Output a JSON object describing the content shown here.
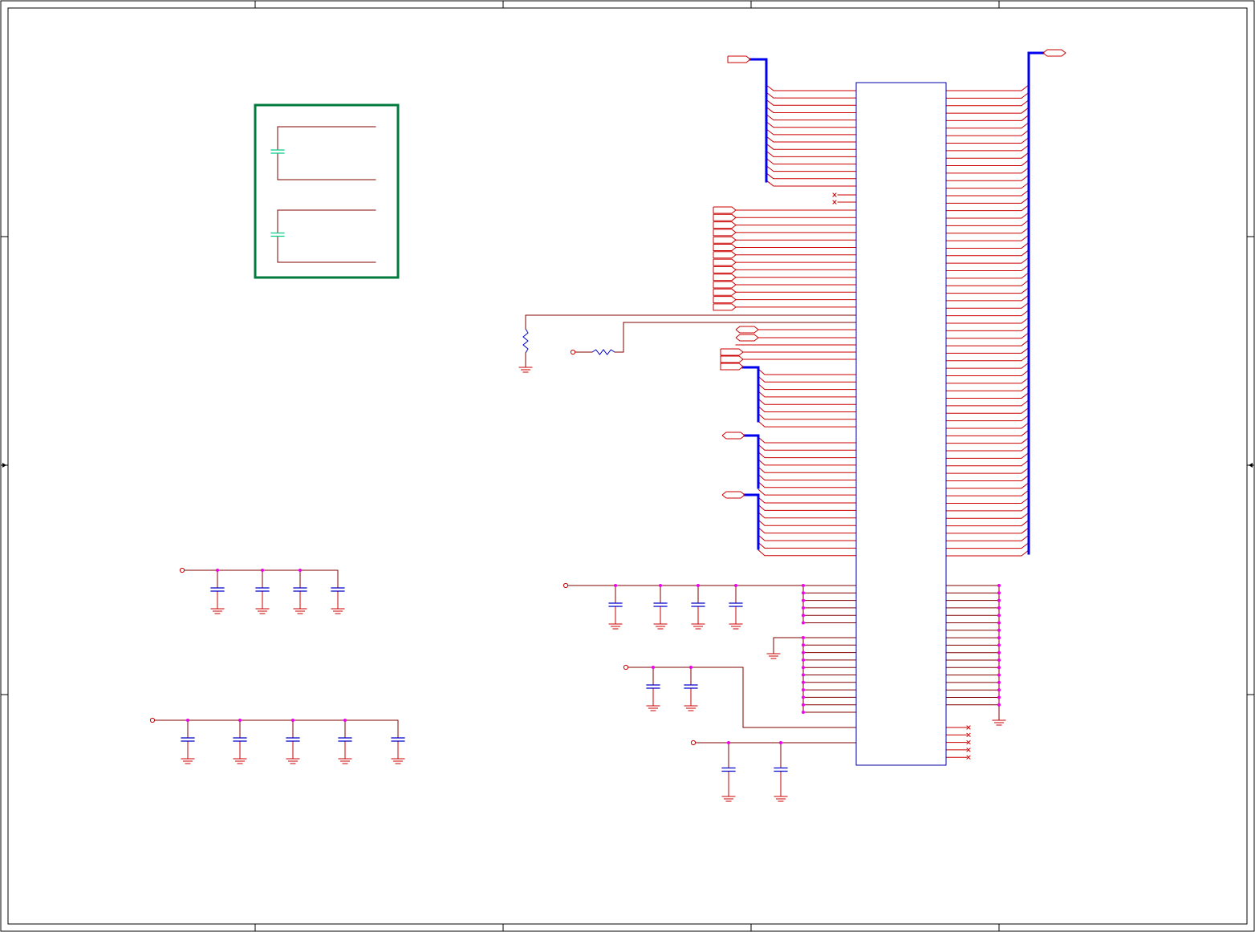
{
  "document": {
    "kind": "schematic-sheet",
    "texts": []
  },
  "colors": {
    "sheet_border": "#000000",
    "net_wire": "#cc0000",
    "power_wire": "#800000",
    "bus": "#0000ee",
    "component_outline": "#0000aa",
    "resistor": "#0000cc",
    "capacitor": "#0000cc",
    "junction": "#ee00ee",
    "decoupling_group_box": "#007a3d",
    "decoupling_cap": "#00cc88",
    "ground": "#cc0000"
  },
  "symbols": {
    "main_connector": "connector-symbol",
    "bus_entry": "bus-entry",
    "port": "port-flag",
    "no_connect": "no-connect-x",
    "ground": "ground-symbol",
    "power_pin": "power-pin-circle",
    "resistor": "resistor-symbol",
    "capacitor": "capacitor-symbol"
  }
}
